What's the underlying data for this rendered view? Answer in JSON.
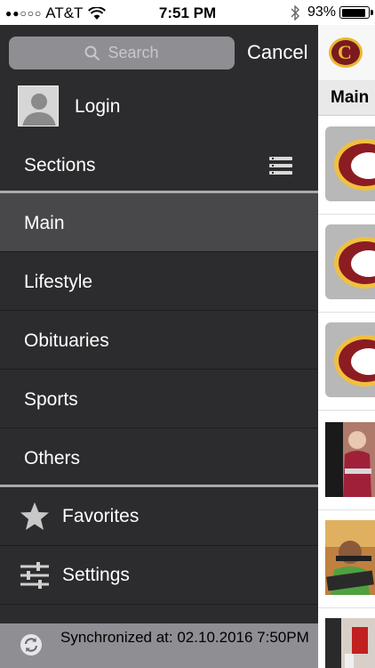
{
  "status_bar": {
    "signal_dots": "●●○○○",
    "carrier": "AT&T",
    "time": "7:51 PM",
    "battery_text": "93%",
    "battery_level": 0.93
  },
  "search": {
    "placeholder": "Search",
    "cancel_label": "Cancel"
  },
  "login": {
    "label": "Login"
  },
  "sections": {
    "label": "Sections"
  },
  "menu": {
    "items": [
      {
        "label": "Main",
        "active": true
      },
      {
        "label": "Lifestyle",
        "active": false
      },
      {
        "label": "Obituaries",
        "active": false
      },
      {
        "label": "Sports",
        "active": false
      },
      {
        "label": "Others",
        "active": false
      }
    ]
  },
  "extras": {
    "favorites_label": "Favorites",
    "settings_label": "Settings"
  },
  "sync": {
    "text": "Synchronized at: 02.10.2016 7:50PM"
  },
  "content": {
    "tab_label": "Main"
  },
  "colors": {
    "drawer_bg": "#2c2c2e",
    "active_bg": "#48484a",
    "sync_bg": "#8e8e93",
    "brand_maroon": "#8b1c22",
    "brand_gold": "#f0c040"
  }
}
